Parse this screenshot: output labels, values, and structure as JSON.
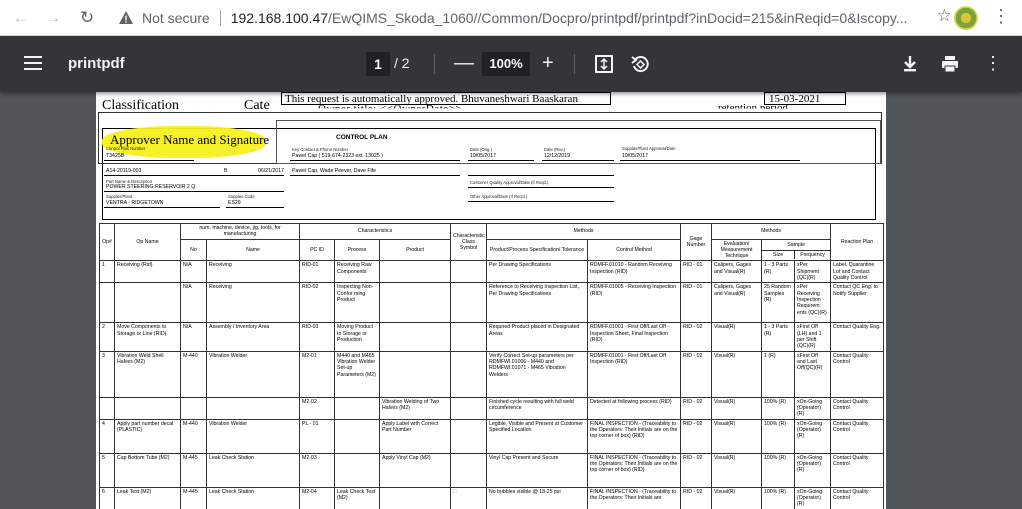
{
  "browser": {
    "security_label": "Not secure",
    "url_host": "192.168.100.47",
    "url_path": "/EwQIMS_Skoda_1060//Common/Docpro/printpdf/printpdf?inDocid=215&inReqid=0&Iscopy..."
  },
  "pdf_toolbar": {
    "title": "printpdf",
    "current_page": "1",
    "total_pages": "/ 2",
    "zoom": "100%"
  },
  "doc_header": {
    "classification": "Classification",
    "category": "Cate",
    "approved_text": "This request is automatically approved. Bhuvaneshwari Baaskaran",
    "owner_text": "Owner title: <<OwnerDate>>",
    "date": "15-03-2021",
    "retention": "retention period",
    "approver_label": "Approver Name and Signature"
  },
  "control_plan": {
    "title": "CONTROL PLAN",
    "fields": {
      "control_plan_number_label": "Control Plan Number",
      "control_plan_number": "T3425B",
      "key_contact_label": "Key Contact & Phone Number",
      "key_contact": "Pawel Cap ( 519-674-2323 ext. 13025 )",
      "date_orig_label": "Date (Orig.)",
      "date_orig": "10/05/2017",
      "date_rev_label": "Date (Rev.)",
      "date_rev": "12/12/2019",
      "supplier_approval_label": "Supplier/Plant Approval/Date",
      "supplier_approval": "10/05/2017",
      "part_number": "A14-20119-003",
      "part_rev": "B",
      "part_rev_date": "06/21/2017",
      "core_team": "Pawel Cap, Wade Peever, Dave Fife",
      "part_name_label": "Part Name & Description",
      "part_name": "POWER STEERING RESERVOIR 2 Q",
      "customer_eng_label": "Customer Quality Approval/Date (If Reqd.)",
      "supplier_plant_label": "Supplier/Plant",
      "supplier_plant": "VENTRA - RIDGETOWN",
      "supplier_code_label": "Supplier Code",
      "supplier_code": "ES29",
      "other_approval_label": "Other Approval/Date (If Req'd.)"
    },
    "columns": {
      "op": "Op#",
      "op_name": "Op Name",
      "machine": "num. machine, device, jig, tools, for manufacturing",
      "no": "No",
      "name": "Name",
      "characteristics": "Characteristics",
      "pc_id": "PC ID",
      "process": "Process",
      "product": "Product",
      "char_class": "Characteristic Class Symbol",
      "methods": "Methods",
      "spec": "Product/Process Specification/ Tolerance",
      "control_method": "Control Method",
      "gage": "Gage Number",
      "methods2": "Methods",
      "evaluation": "Evaluation/ Measurement Technique",
      "sample": "Sample",
      "size": "Size",
      "frequency": "Frequency",
      "reaction": "Reaction Plan"
    },
    "rows": [
      {
        "op": "1",
        "op_name": "Receiving (Rid)",
        "no": "N/A",
        "name": "Receiving",
        "pc_id": "RID-01",
        "process": "Receiving Raw Components",
        "product": "",
        "spec": "Per Drawing Specifications",
        "control": "RDMFF.01010 - Random Receiving Inspection (RID)",
        "gage": "RID - 01",
        "eval": "Calipers, Gages and Visual(R)",
        "size": "1 - 3 Parts (R)",
        "freq": "xPer Shipment (QC)(R)",
        "reaction": "Label, Quarantine Lot and Contact Quality Control"
      },
      {
        "op": "",
        "op_name": "",
        "no": "N/A",
        "name": "Receiving",
        "pc_id": "RID-02",
        "process": "Inspecting Non-Confor ming Product",
        "product": "",
        "spec": "Reference to Receiving Inspection List, Per Drawing Specifications",
        "control": "RDMFF.01005 - Receiving Inspection (RID)",
        "gage": "RID - 01",
        "eval": "Calipers, Gages and Visual(R)",
        "size": "25 Random Samples (R)",
        "freq": "xPer Receiving Inspection Requirem ents (QC)(R)",
        "reaction": "Contact QC Eng. to Notify Supplier"
      },
      {
        "op": "2",
        "op_name": "Move Components to Storage or Line (RID)",
        "no": "N/A",
        "name": "Assembly / Inventory Area",
        "pc_id": "RID-03",
        "process": "Moving Product to Storage or Production",
        "product": "",
        "spec": "Required Product placed in Designated Areas",
        "control": "RDMFF.01001 - First Off/Last Off - Inspection Sheet, Final Inspection (RID)",
        "gage": "RID - 02",
        "eval": "Visual(R)",
        "size": "1 - 3 Parts (R)",
        "freq": "xFirst Off (LH) and 1 per Shift (QC)(R)",
        "reaction": "Contact Quality Eng."
      },
      {
        "op": "3",
        "op_name": "Vibration Weld Shell Halves (M2)",
        "no": "M-440",
        "name": "Vibration Welder",
        "pc_id": "M2-01",
        "process": "M440 and M465 Vibration Welder Set-up Parameters (M2)",
        "product": "",
        "spec": "Verify Correct Set-up parameters per RDMFWI.01006 - M440 and RDMFWI.01071 - M465 Vibration Welders",
        "control": "RDMFF.01001 - First Off/Last Off Inspection (RID)",
        "gage": "RID - 02",
        "eval": "Visual(R)",
        "size": "1 (R)",
        "freq": "xFirst Off and Last Off(QC)(R)",
        "reaction": "Contact Quality Control"
      },
      {
        "op": "",
        "op_name": "",
        "no": "",
        "name": "",
        "pc_id": "M2-02",
        "process": "",
        "product": "Vibration Welding of Two Halves (M2)",
        "spec": "Finished cycle resulting with full weld circumference",
        "control": "Detected at following process (RID)",
        "gage": "RID - 02",
        "eval": "Visual(R)",
        "size": "100% (R)",
        "freq": "xOn-Going (Operator) (R)",
        "reaction": "Contact Quality Control"
      },
      {
        "op": "4",
        "op_name": "Apply part number decal (PLASTIC)",
        "no": "M-440",
        "name": "Vibration Welder",
        "pc_id": "PL - 01",
        "process": "",
        "product": "Apply Label with Correct Part Number",
        "spec": "Legible, Visible and Present at Customer Specified Location",
        "control": "FINAL INSPECTION - (Traceability to the Operators: Their Initials are on the top corner of box) (RID)",
        "gage": "RID - 02",
        "eval": "Visual(R)",
        "size": "100% (R)",
        "freq": "xOn-Going (Operator) (R)",
        "reaction": "Contact Quality Control"
      },
      {
        "op": "5",
        "op_name": "Cap Bottom Tube (M2)",
        "no": "M-445",
        "name": "Leak Check Station",
        "pc_id": "M2-03",
        "process": "",
        "product": "Apply Vinyl Cap (M2)",
        "spec": "Vinyl Cap Present and Secure",
        "control": "FINAL INSPECTION - (Traceability to the Operators: Their Initials are on the top corner of box) (RID)",
        "gage": "RID - 02",
        "eval": "Visual(R)",
        "size": "100% (R)",
        "freq": "xOn-Going (Operator) (R)",
        "reaction": "Contact Quality Control"
      },
      {
        "op": "6",
        "op_name": "Leak Test (M2)",
        "no": "M-445",
        "name": "Leak Check Station",
        "pc_id": "M2-04",
        "process": "Leak Check Test (M2)",
        "product": "",
        "spec": "No bubbles visible @ 18-25 psi",
        "control": "FINAL INSPECTION - (Traceability to the Operators: Their Initials are",
        "gage": "RID - 02",
        "eval": "Visual(R)",
        "size": "100% (R)",
        "freq": "xOn-Going (Operator) (R)",
        "reaction": "Contact Quality Control"
      }
    ]
  }
}
